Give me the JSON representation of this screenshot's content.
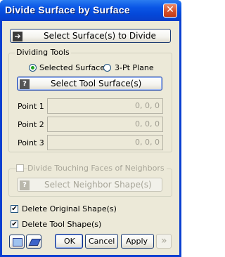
{
  "window": {
    "title": "Divide Surface by Surface",
    "close_glyph": "✕"
  },
  "buttons": {
    "select_surfaces": "Select Surface(s) to Divide",
    "select_tool": "Select Tool Surface(s)",
    "select_neighbor": "Select Neighbor Shape(s)",
    "ok": "OK",
    "cancel": "Cancel",
    "apply": "Apply",
    "more": "»"
  },
  "dividing_tools": {
    "legend": "Dividing Tools",
    "radio_selected_surface": "Selected Surface",
    "radio_3pt_plane": "3-Pt Plane",
    "selected_option": "Selected Surface",
    "points": [
      {
        "label": "Point 1",
        "value": "0, 0, 0"
      },
      {
        "label": "Point 2",
        "value": "0, 0, 0"
      },
      {
        "label": "Point 3",
        "value": "0, 0, 0"
      }
    ]
  },
  "neighbors": {
    "checkbox_label": "Divide Touching Faces of Neighbors",
    "checked": false
  },
  "options": {
    "delete_original": {
      "label": "Delete Original Shape(s)",
      "checked": true
    },
    "delete_tool": {
      "label": "Delete Tool Shape(s)",
      "checked": true
    }
  },
  "icons": {
    "select_arrow": "arrow-right-icon",
    "question": "?",
    "check": "✔"
  }
}
